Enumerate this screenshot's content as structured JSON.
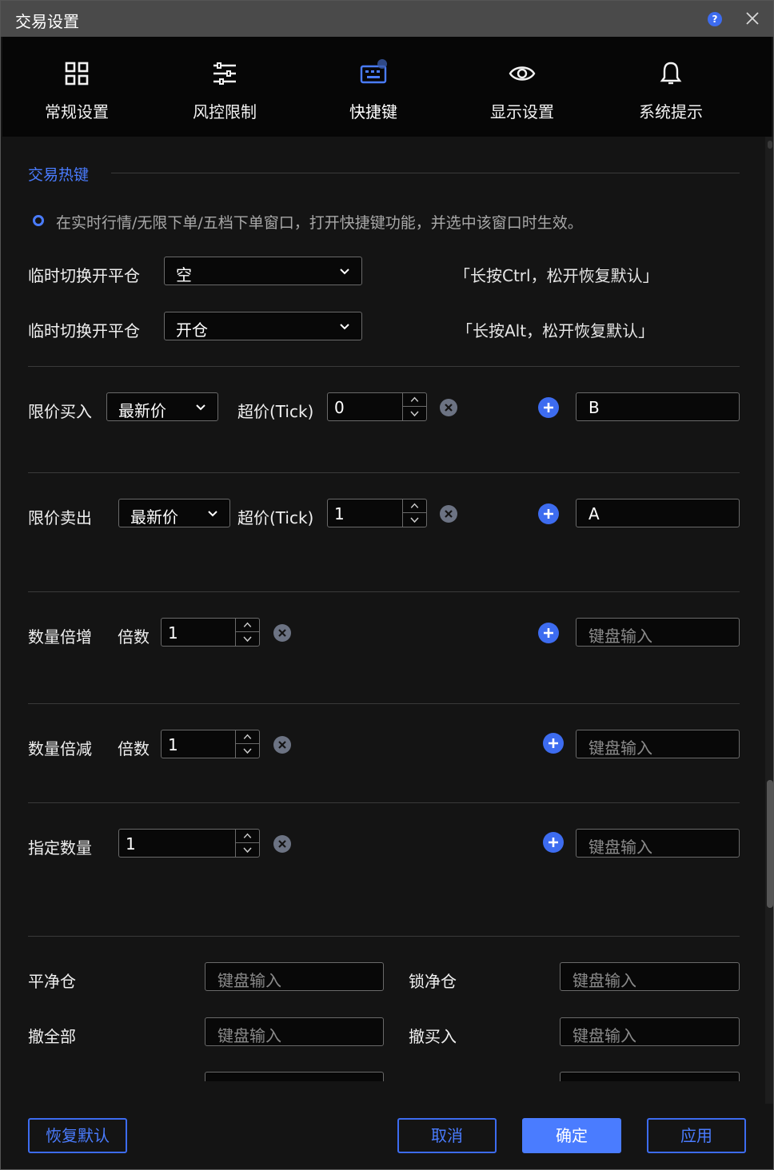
{
  "window": {
    "title": "交易设置"
  },
  "nav": [
    {
      "label": "常规设置",
      "icon": "grid-icon"
    },
    {
      "label": "风控限制",
      "icon": "sliders-icon"
    },
    {
      "label": "快捷键",
      "icon": "keyboard-icon"
    },
    {
      "label": "显示设置",
      "icon": "eye-icon"
    },
    {
      "label": "系统提示",
      "icon": "bell-icon"
    }
  ],
  "active_tab": "快捷键",
  "section": {
    "title": "交易热键",
    "hint": "在实时行情/无限下单/五档下单窗口，打开快捷键功能，并选中该窗口时生效。"
  },
  "toggles": [
    {
      "label": "临时切换开平仓",
      "value": "空",
      "note": "「长按Ctrl，松开恢复默认」"
    },
    {
      "label": "临时切换开平仓",
      "value": "开仓",
      "note": "「长按Alt，松开恢复默认」"
    }
  ],
  "limit_buy": {
    "label": "限价买入",
    "price_type": "最新价",
    "tick_label": "超价(Tick)",
    "tick_value": "0",
    "key": "B"
  },
  "limit_sell": {
    "label": "限价卖出",
    "price_type": "最新价",
    "tick_label": "超价(Tick)",
    "tick_value": "1",
    "key": "A"
  },
  "qty_increase": {
    "label": "数量倍增",
    "mult_label": "倍数",
    "value": "1",
    "key_placeholder": "键盘输入"
  },
  "qty_decrease": {
    "label": "数量倍减",
    "mult_label": "倍数",
    "value": "1",
    "key_placeholder": "键盘输入"
  },
  "qty_fixed": {
    "label": "指定数量",
    "value": "1",
    "key_placeholder": "键盘输入"
  },
  "grid_keys": [
    {
      "label": "平净仓",
      "placeholder": "键盘输入"
    },
    {
      "label": "锁净仓",
      "placeholder": "键盘输入"
    },
    {
      "label": "撤全部",
      "placeholder": "键盘输入"
    },
    {
      "label": "撤买入",
      "placeholder": "键盘输入"
    }
  ],
  "footer": {
    "reset": "恢复默认",
    "cancel": "取消",
    "ok": "确定",
    "apply": "应用"
  },
  "colors": {
    "accent": "#4a7cff",
    "background": "#141414",
    "titlebar": "#4a4a4a"
  }
}
